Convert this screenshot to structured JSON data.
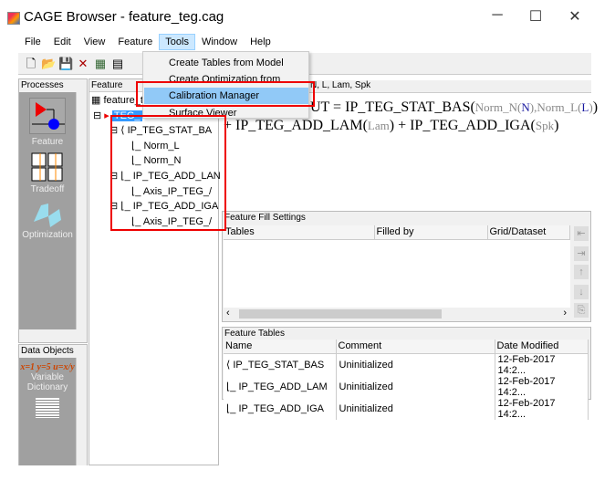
{
  "window": {
    "title": "CAGE Browser - feature_teg.cag",
    "minimize": "─",
    "maximize": "☐",
    "close": "✕"
  },
  "menubar": [
    "File",
    "Edit",
    "View",
    "Feature",
    "Tools",
    "Window",
    "Help"
  ],
  "tools_menu": {
    "items": [
      "Create Tables from Model",
      "Create Optimization from Model",
      "Calibration Manager",
      "Surface Viewer"
    ],
    "highlighted": "Calibration Manager"
  },
  "processes": {
    "header": "Processes",
    "items": [
      {
        "label": "Feature",
        "icon": "feature-icon"
      },
      {
        "label": "Tradeoff",
        "icon": "tradeoff-icon"
      },
      {
        "label": "Optimization",
        "icon": "optimization-icon"
      }
    ]
  },
  "data_objects": {
    "header": "Data Objects",
    "items": [
      {
        "label": "Variable Dictionary",
        "icon": "variable-dictionary-icon",
        "glyph": "x=1 y=5 u=x/y"
      }
    ]
  },
  "tree": {
    "header": "Feature",
    "root": "feature_t",
    "selected": "TEG_",
    "nodes": [
      "IP_TEG_STAT_BA",
      "Norm_L",
      "Norm_N",
      "IP_TEG_ADD_LAN",
      "Axis_IP_TEG_/",
      "IP_TEG_ADD_IGA",
      "Axis_IP_TEG_/"
    ]
  },
  "equation": {
    "header": "N, L, Lam, Spk",
    "line1": {
      "a": "UT = IP_TEG_STAT_BAS(",
      "n1": "Norm_N(",
      "v1": "N",
      "n1c": "),Norm_L(",
      "v2": "L",
      "n2c": ")",
      "end": ")"
    },
    "line2": {
      "a": "+ IP_TEG_ADD_LAM(",
      "g1": "Lam",
      "b": ") + IP_TEG_ADD_IGA(",
      "g2": "Spk",
      "end": ")"
    }
  },
  "fill_settings": {
    "header": "Feature Fill Settings",
    "columns": [
      "Tables",
      "Filled by",
      "Grid/Dataset"
    ]
  },
  "feature_tables": {
    "header": "Feature Tables",
    "columns": [
      "Name",
      "Comment",
      "Date Modified"
    ],
    "rows": [
      [
        "IP_TEG_STAT_BAS",
        "Uninitialized",
        "12-Feb-2017 14:2..."
      ],
      [
        "IP_TEG_ADD_LAM",
        "Uninitialized",
        "12-Feb-2017 14:2..."
      ],
      [
        "IP_TEG_ADD_IGA",
        "Uninitialized",
        "12-Feb-2017 14:2..."
      ]
    ]
  },
  "colors": {
    "highlight_box": "#e00000",
    "menu_highlight": "#91c9f7",
    "selection": "#3399ff"
  }
}
